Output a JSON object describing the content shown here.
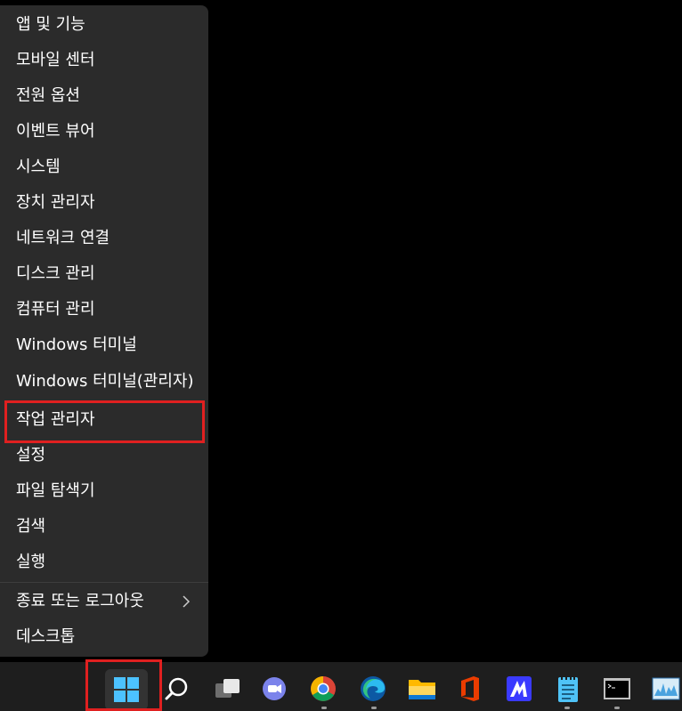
{
  "menu": {
    "items": [
      {
        "label": "앱 및 기능"
      },
      {
        "label": "모바일 센터"
      },
      {
        "label": "전원 옵션"
      },
      {
        "label": "이벤트 뷰어"
      },
      {
        "label": "시스템"
      },
      {
        "label": "장치 관리자"
      },
      {
        "label": "네트워크 연결"
      },
      {
        "label": "디스크 관리"
      },
      {
        "label": "컴퓨터 관리"
      },
      {
        "label": "Windows 터미널"
      },
      {
        "label": "Windows 터미널(관리자)"
      },
      {
        "label": "작업 관리자"
      },
      {
        "label": "설정"
      },
      {
        "label": "파일 탐색기"
      },
      {
        "label": "검색"
      },
      {
        "label": "실행"
      },
      {
        "label": "종료 또는 로그아웃"
      },
      {
        "label": "데스크톱"
      }
    ],
    "highlighted_item": "작업 관리자"
  },
  "taskbar": {
    "icons": [
      "windows-start-icon",
      "search-icon",
      "task-view-icon",
      "teams-chat-icon",
      "chrome-icon",
      "edge-icon",
      "file-explorer-icon",
      "office-icon",
      "app-icon",
      "notepad-icon",
      "terminal-icon",
      "performance-monitor-icon"
    ],
    "highlighted_icon": "windows-start-icon"
  },
  "colors": {
    "menu_bg": "#2b2b2b",
    "taskbar_bg": "#1e1e1e",
    "highlight": "#e02020",
    "text": "#ffffff"
  }
}
